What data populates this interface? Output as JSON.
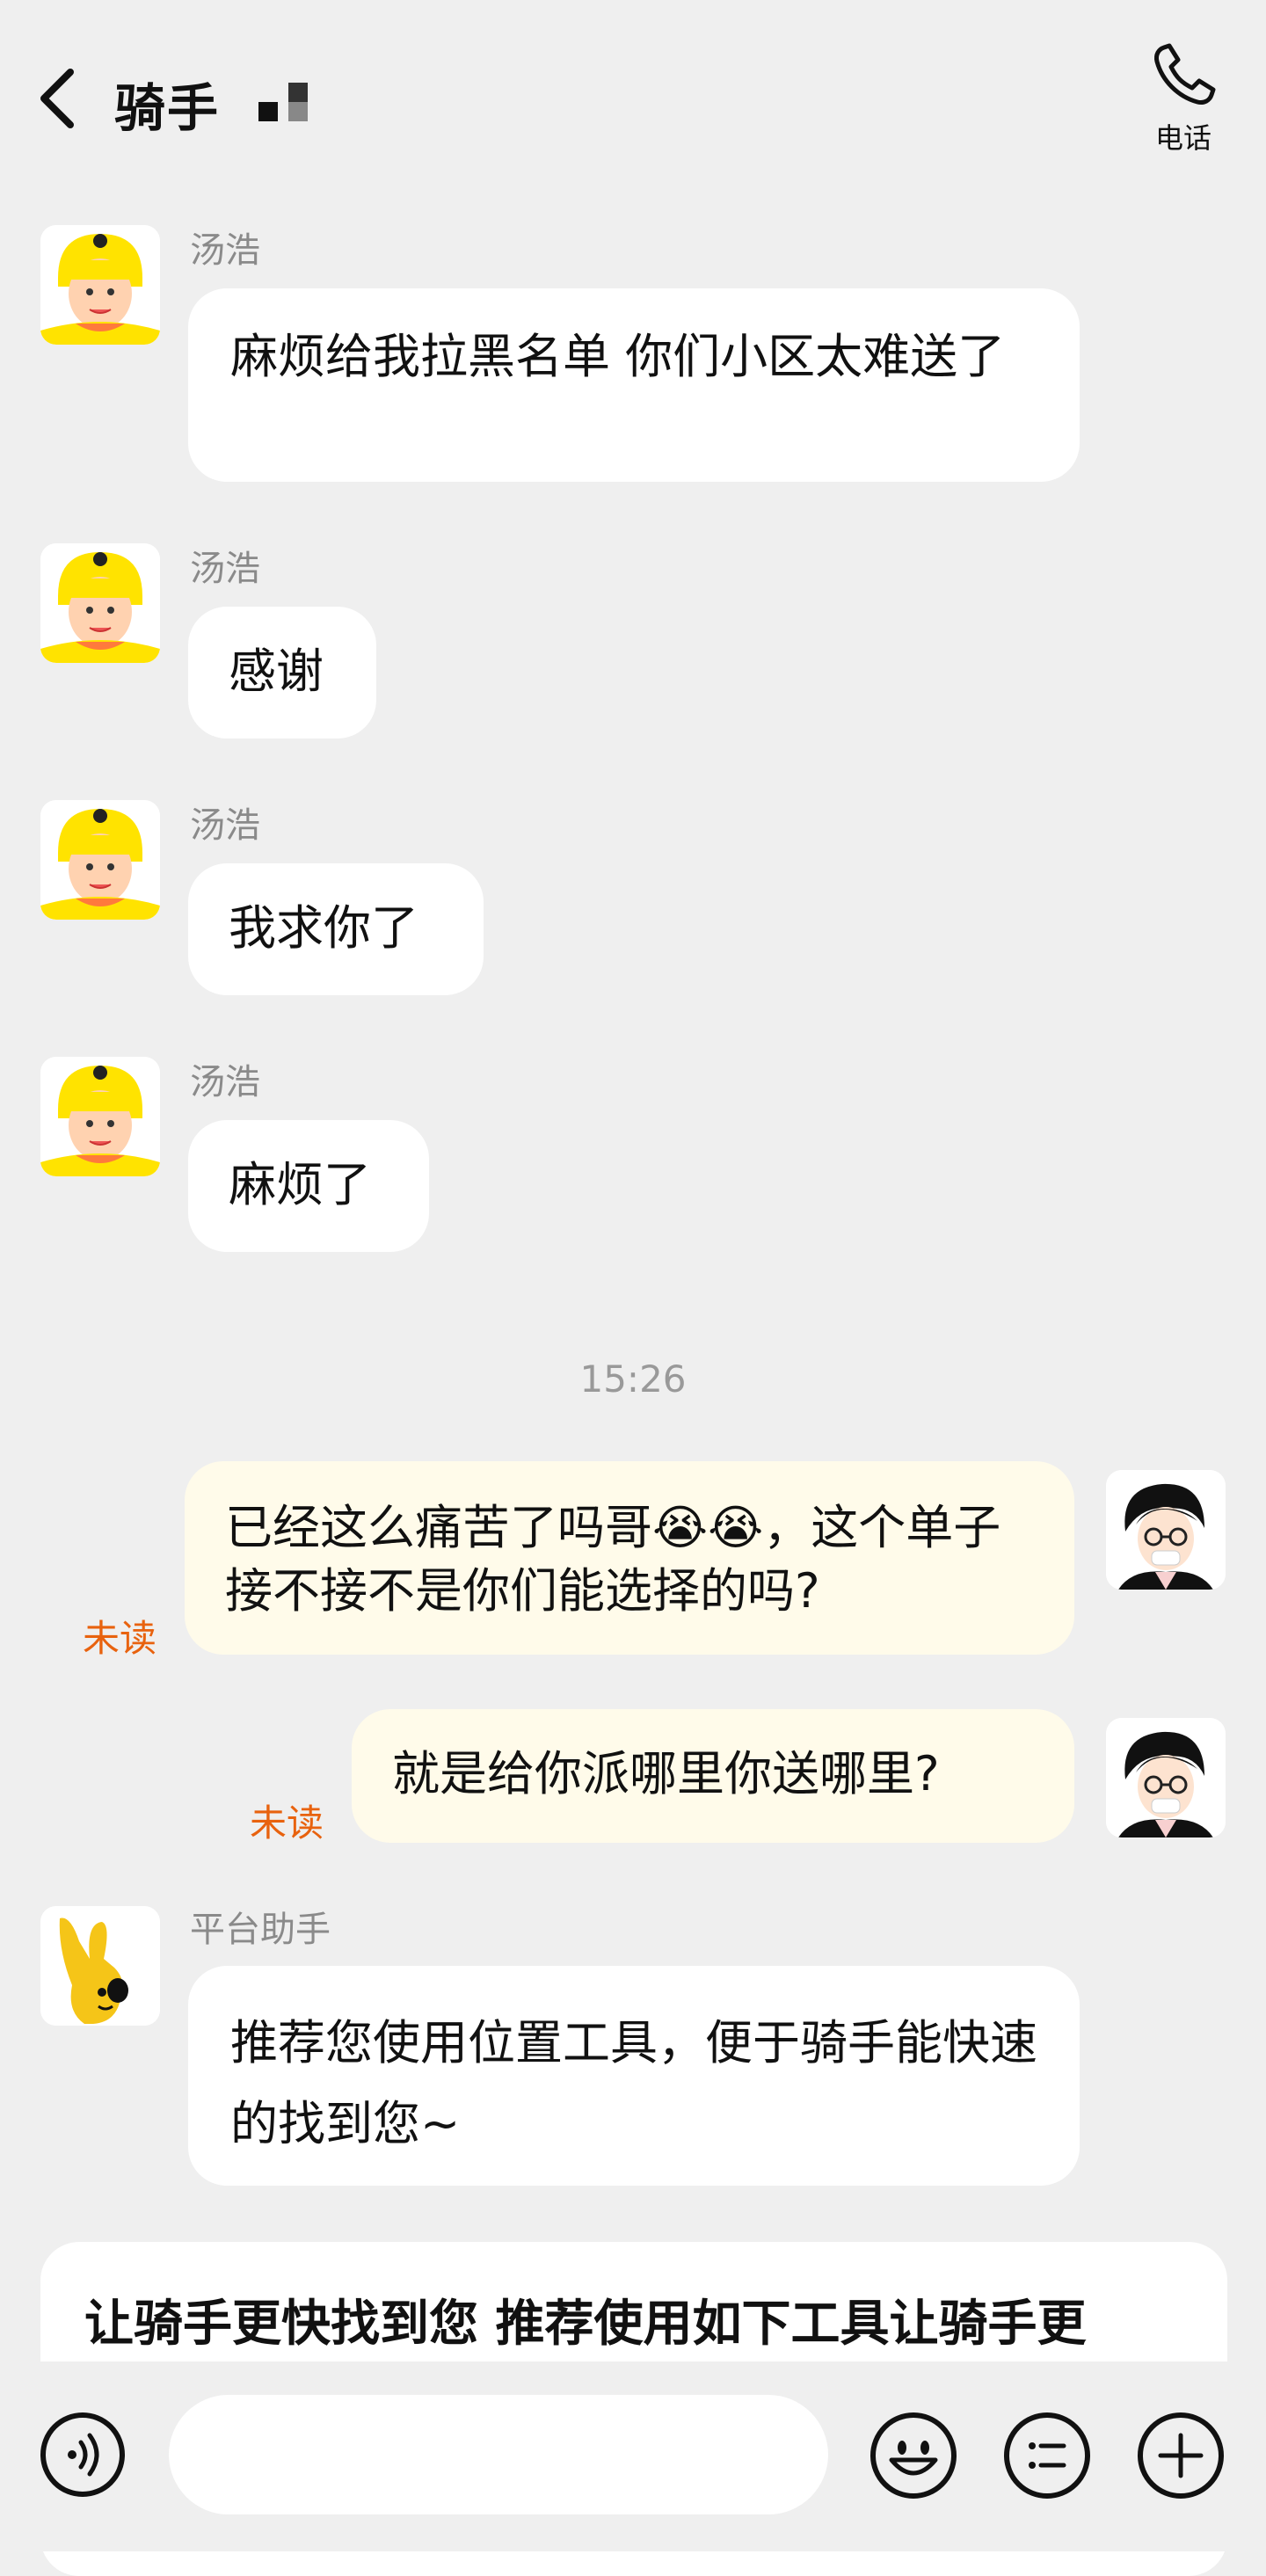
{
  "header": {
    "title": "骑手",
    "phone_label": "电话"
  },
  "messages": [
    {
      "sender": "汤浩",
      "text": "麻烦给我拉黑名单  你们小区太难送了"
    },
    {
      "sender": "汤浩",
      "text": "感谢"
    },
    {
      "sender": "汤浩",
      "text": "我求你了"
    },
    {
      "sender": "汤浩",
      "text": "麻烦了"
    },
    {
      "text": "已经这么痛苦了吗哥😭😭，这个单子接不接不是你们能选择的吗?",
      "status": "未读"
    },
    {
      "text": "就是给你派哪里你送哪里?",
      "status": "未读"
    },
    {
      "sender": "平台助手",
      "text": "推荐您使用位置工具，便于骑手能快速的找到您~"
    }
  ],
  "timestamp": "15:26",
  "card": {
    "title": "让骑手更快找到您 推荐使用如下工具让骑手更"
  },
  "input": {
    "placeholder": ""
  },
  "colors": {
    "background": "#efefef",
    "bubble_other": "#ffffff",
    "bubble_mine": "#fffbea",
    "unread": "#e8620e",
    "rider_avatar_bg": "#ffe300"
  },
  "icons": [
    "back-chevron-icon",
    "phone-icon",
    "voice-icon",
    "emoji-icon",
    "quick-reply-icon",
    "plus-icon"
  ]
}
